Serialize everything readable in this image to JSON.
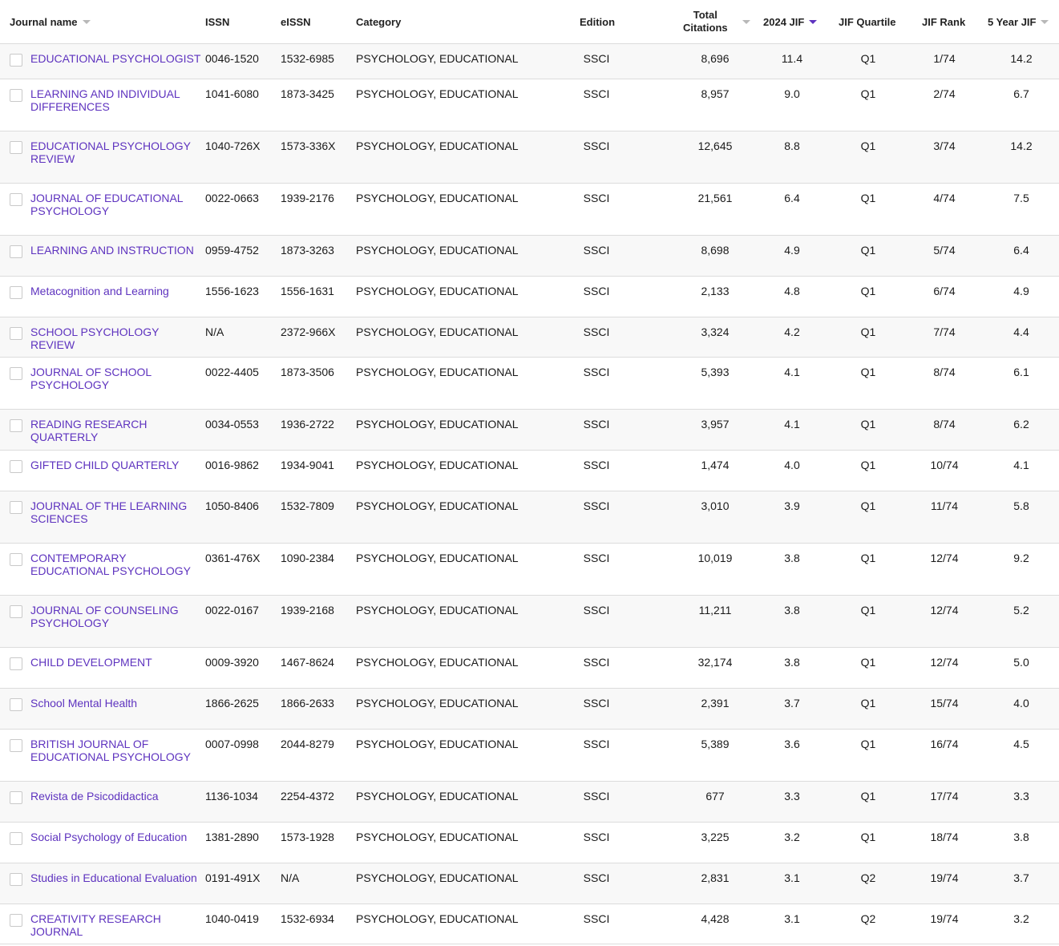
{
  "header": {
    "journal_name": "Journal name",
    "issn": "ISSN",
    "eissn": "eISSN",
    "category": "Category",
    "edition": "Edition",
    "total_citations_1": "Total",
    "total_citations_2": "Citations",
    "jif_2024": "2024 JIF",
    "jif_quartile": "JIF Quartile",
    "jif_rank": "JIF Rank",
    "five_year_jif": "5 Year JIF"
  },
  "colors": {
    "link": "#5e33bf",
    "active_sort": "#5e33bf",
    "inactive_sort": "#b8b8b8",
    "row_alt": "#f8f8f8",
    "border": "#dcdcdc"
  },
  "rows": [
    {
      "name": "EDUCATIONAL PSYCHOLOGIST",
      "issn": "0046-1520",
      "eissn": "1532-6985",
      "category": "PSYCHOLOGY, EDUCATIONAL",
      "edition": "SSCI",
      "citations": "8,696",
      "jif": "11.4",
      "quartile": "Q1",
      "rank": "1/74",
      "five_year": "14.2"
    },
    {
      "name": "LEARNING AND INDIVIDUAL DIFFERENCES",
      "issn": "1041-6080",
      "eissn": "1873-3425",
      "category": "PSYCHOLOGY, EDUCATIONAL",
      "edition": "SSCI",
      "citations": "8,957",
      "jif": "9.0",
      "quartile": "Q1",
      "rank": "2/74",
      "five_year": "6.7"
    },
    {
      "name": "EDUCATIONAL PSYCHOLOGY REVIEW",
      "issn": "1040-726X",
      "eissn": "1573-336X",
      "category": "PSYCHOLOGY, EDUCATIONAL",
      "edition": "SSCI",
      "citations": "12,645",
      "jif": "8.8",
      "quartile": "Q1",
      "rank": "3/74",
      "five_year": "14.2"
    },
    {
      "name": "JOURNAL OF EDUCATIONAL PSYCHOLOGY",
      "issn": "0022-0663",
      "eissn": "1939-2176",
      "category": "PSYCHOLOGY, EDUCATIONAL",
      "edition": "SSCI",
      "citations": "21,561",
      "jif": "6.4",
      "quartile": "Q1",
      "rank": "4/74",
      "five_year": "7.5"
    },
    {
      "name": "LEARNING AND INSTRUCTION",
      "issn": "0959-4752",
      "eissn": "1873-3263",
      "category": "PSYCHOLOGY, EDUCATIONAL",
      "edition": "SSCI",
      "citations": "8,698",
      "jif": "4.9",
      "quartile": "Q1",
      "rank": "5/74",
      "five_year": "6.4"
    },
    {
      "name": "Metacognition and Learning",
      "issn": "1556-1623",
      "eissn": "1556-1631",
      "category": "PSYCHOLOGY, EDUCATIONAL",
      "edition": "SSCI",
      "citations": "2,133",
      "jif": "4.8",
      "quartile": "Q1",
      "rank": "6/74",
      "five_year": "4.9"
    },
    {
      "name": "SCHOOL PSYCHOLOGY REVIEW",
      "issn": "N/A",
      "eissn": "2372-966X",
      "category": "PSYCHOLOGY, EDUCATIONAL",
      "edition": "SSCI",
      "citations": "3,324",
      "jif": "4.2",
      "quartile": "Q1",
      "rank": "7/74",
      "five_year": "4.4"
    },
    {
      "name": "JOURNAL OF SCHOOL PSYCHOLOGY",
      "issn": "0022-4405",
      "eissn": "1873-3506",
      "category": "PSYCHOLOGY, EDUCATIONAL",
      "edition": "SSCI",
      "citations": "5,393",
      "jif": "4.1",
      "quartile": "Q1",
      "rank": "8/74",
      "five_year": "6.1"
    },
    {
      "name": "READING RESEARCH QUARTERLY",
      "issn": "0034-0553",
      "eissn": "1936-2722",
      "category": "PSYCHOLOGY, EDUCATIONAL",
      "edition": "SSCI",
      "citations": "3,957",
      "jif": "4.1",
      "quartile": "Q1",
      "rank": "8/74",
      "five_year": "6.2"
    },
    {
      "name": "GIFTED CHILD QUARTERLY",
      "issn": "0016-9862",
      "eissn": "1934-9041",
      "category": "PSYCHOLOGY, EDUCATIONAL",
      "edition": "SSCI",
      "citations": "1,474",
      "jif": "4.0",
      "quartile": "Q1",
      "rank": "10/74",
      "five_year": "4.1"
    },
    {
      "name": "JOURNAL OF THE LEARNING SCIENCES",
      "issn": "1050-8406",
      "eissn": "1532-7809",
      "category": "PSYCHOLOGY, EDUCATIONAL",
      "edition": "SSCI",
      "citations": "3,010",
      "jif": "3.9",
      "quartile": "Q1",
      "rank": "11/74",
      "five_year": "5.8"
    },
    {
      "name": "CONTEMPORARY EDUCATIONAL PSYCHOLOGY",
      "issn": "0361-476X",
      "eissn": "1090-2384",
      "category": "PSYCHOLOGY, EDUCATIONAL",
      "edition": "SSCI",
      "citations": "10,019",
      "jif": "3.8",
      "quartile": "Q1",
      "rank": "12/74",
      "five_year": "9.2"
    },
    {
      "name": "JOURNAL OF COUNSELING PSYCHOLOGY",
      "issn": "0022-0167",
      "eissn": "1939-2168",
      "category": "PSYCHOLOGY, EDUCATIONAL",
      "edition": "SSCI",
      "citations": "11,211",
      "jif": "3.8",
      "quartile": "Q1",
      "rank": "12/74",
      "five_year": "5.2"
    },
    {
      "name": "CHILD DEVELOPMENT",
      "issn": "0009-3920",
      "eissn": "1467-8624",
      "category": "PSYCHOLOGY, EDUCATIONAL",
      "edition": "SSCI",
      "citations": "32,174",
      "jif": "3.8",
      "quartile": "Q1",
      "rank": "12/74",
      "five_year": "5.0"
    },
    {
      "name": "School Mental Health",
      "issn": "1866-2625",
      "eissn": "1866-2633",
      "category": "PSYCHOLOGY, EDUCATIONAL",
      "edition": "SSCI",
      "citations": "2,391",
      "jif": "3.7",
      "quartile": "Q1",
      "rank": "15/74",
      "five_year": "4.0"
    },
    {
      "name": "BRITISH JOURNAL OF EDUCATIONAL PSYCHOLOGY",
      "issn": "0007-0998",
      "eissn": "2044-8279",
      "category": "PSYCHOLOGY, EDUCATIONAL",
      "edition": "SSCI",
      "citations": "5,389",
      "jif": "3.6",
      "quartile": "Q1",
      "rank": "16/74",
      "five_year": "4.5"
    },
    {
      "name": "Revista de Psicodidactica",
      "issn": "1136-1034",
      "eissn": "2254-4372",
      "category": "PSYCHOLOGY, EDUCATIONAL",
      "edition": "SSCI",
      "citations": "677",
      "jif": "3.3",
      "quartile": "Q1",
      "rank": "17/74",
      "five_year": "3.3"
    },
    {
      "name": "Social Psychology of Education",
      "issn": "1381-2890",
      "eissn": "1573-1928",
      "category": "PSYCHOLOGY, EDUCATIONAL",
      "edition": "SSCI",
      "citations": "3,225",
      "jif": "3.2",
      "quartile": "Q1",
      "rank": "18/74",
      "five_year": "3.8"
    },
    {
      "name": "Studies in Educational Evaluation",
      "issn": "0191-491X",
      "eissn": "N/A",
      "category": "PSYCHOLOGY, EDUCATIONAL",
      "edition": "SSCI",
      "citations": "2,831",
      "jif": "3.1",
      "quartile": "Q2",
      "rank": "19/74",
      "five_year": "3.7"
    },
    {
      "name": "CREATIVITY RESEARCH JOURNAL",
      "issn": "1040-0419",
      "eissn": "1532-6934",
      "category": "PSYCHOLOGY, EDUCATIONAL",
      "edition": "SSCI",
      "citations": "4,428",
      "jif": "3.1",
      "quartile": "Q2",
      "rank": "19/74",
      "five_year": "3.2"
    }
  ]
}
